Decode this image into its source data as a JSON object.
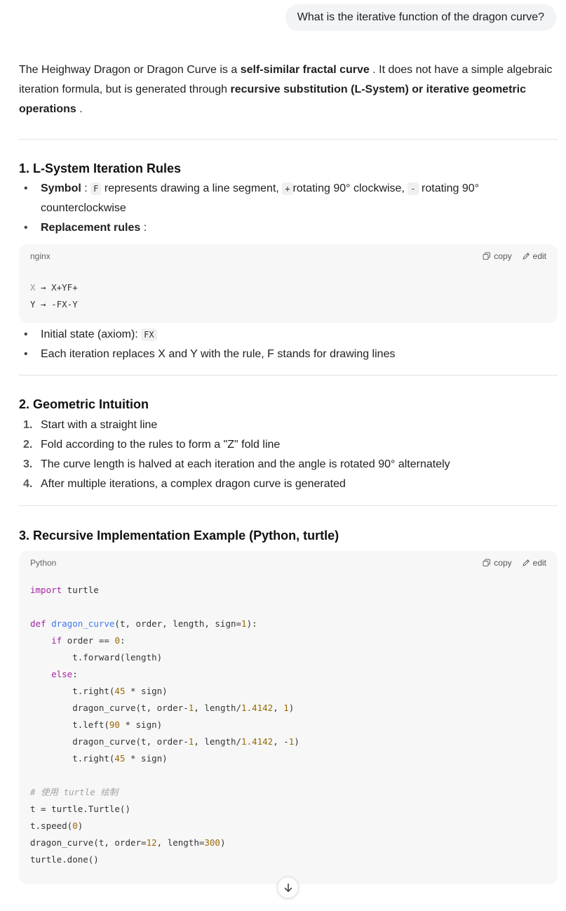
{
  "user_message": "What is the iterative function of the dragon curve?",
  "intro": {
    "t1": "The Heighway Dragon or Dragon Curve is a ",
    "b1": "self-similar fractal curve",
    "t2": " . It does not have a simple algebraic iteration formula, but is generated through ",
    "b2": "recursive substitution (L-System) or iterative geometric operations",
    "t3": " ."
  },
  "section1": {
    "title": "1. L-System Iteration Rules",
    "symbol_label": "Symbol",
    "symbol_colon": " : ",
    "sym_f": "F",
    "sym_f_text": " represents drawing a line segment, ",
    "sym_plus": "+",
    "sym_plus_text": "rotating 90° clockwise, ",
    "sym_minus": "-",
    "sym_minus_text": " rotating 90° counterclockwise",
    "rules_label": "Replacement rules",
    "rules_colon": " :",
    "code_lang": "nginx",
    "copy_label": "copy",
    "edit_label": "edit",
    "rule_x_lhs": "X",
    "rule_x_rhs": " → X+YF+",
    "rule_y": "Y → -FX-Y",
    "axiom_text": "Initial state (axiom): ",
    "axiom_code": "FX",
    "each_iter": "Each iteration replaces X and Y with the rule, F stands for drawing lines"
  },
  "section2": {
    "title": "2. Geometric Intuition",
    "items": [
      {
        "num": "1.",
        "text": "Start with a straight line"
      },
      {
        "num": "2.",
        "text": "Fold according to the rules to form a \"Z\" fold line"
      },
      {
        "num": "3.",
        "text": "The curve length is halved at each iteration and the angle is rotated 90° alternately"
      },
      {
        "num": "4.",
        "text": "After multiple iterations, a complex dragon curve is generated"
      }
    ]
  },
  "section3": {
    "title": "3. Recursive Implementation Example (Python, turtle)",
    "code_lang": "Python",
    "copy_label": "copy",
    "edit_label": "edit",
    "comment_line": "# 使用 turtle 绘制"
  },
  "icons": {
    "copy": "copy-icon",
    "edit": "edit-icon",
    "scroll": "arrow-down-icon"
  }
}
